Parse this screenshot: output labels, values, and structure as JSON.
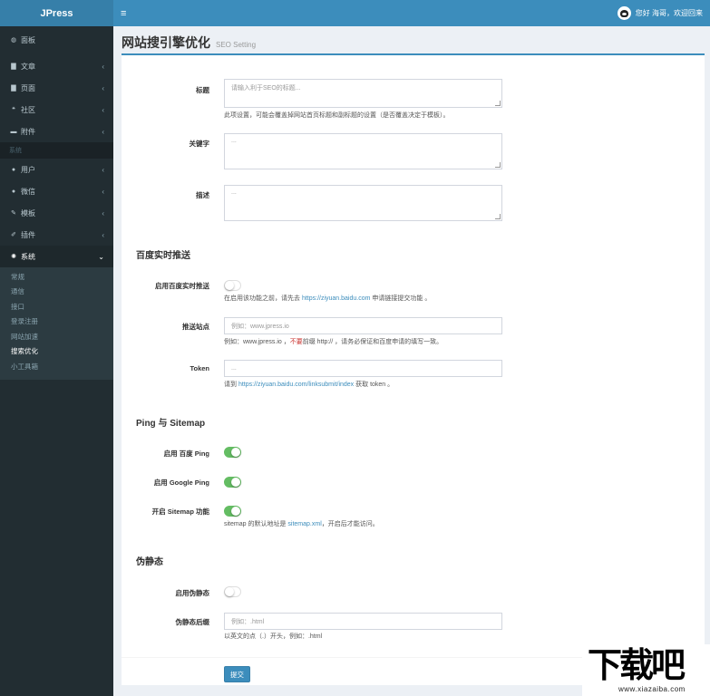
{
  "brand": "JPress",
  "topbar": {
    "menu_icon": "≡",
    "user_text": "您好 海哥，欢迎回来"
  },
  "sidebar": {
    "items": [
      {
        "icon": "dashboard-icon",
        "glyph": "◍",
        "label": "面板",
        "arrow": ""
      },
      {
        "icon": "article-icon",
        "glyph": "▇",
        "label": "文章",
        "arrow": "‹"
      },
      {
        "icon": "page-icon",
        "glyph": "▇",
        "label": "页面",
        "arrow": "‹"
      },
      {
        "icon": "community-icon",
        "glyph": "❝",
        "label": "社区",
        "arrow": "‹"
      },
      {
        "icon": "attachment-icon",
        "glyph": "▬",
        "label": "附件",
        "arrow": "‹"
      }
    ],
    "header": "系统",
    "items2": [
      {
        "icon": "user-icon",
        "glyph": "●",
        "label": "用户",
        "arrow": "‹"
      },
      {
        "icon": "wechat-icon",
        "glyph": "●",
        "label": "微信",
        "arrow": "‹"
      },
      {
        "icon": "template-icon",
        "glyph": "✎",
        "label": "模板",
        "arrow": "‹"
      },
      {
        "icon": "plugin-icon",
        "glyph": "✐",
        "label": "插件",
        "arrow": "‹"
      }
    ],
    "system": {
      "icon": "gear-icon",
      "glyph": "✺",
      "label": "系统",
      "arrow": "⌄"
    },
    "sub_items": [
      "常规",
      "通信",
      "接口",
      "登录注册",
      "网站加速",
      "搜索优化",
      "小工具箱"
    ],
    "active_sub": "搜索优化"
  },
  "page": {
    "title": "网站搜引擎优化",
    "subtitle": "SEO Setting"
  },
  "form": {
    "title_label": "标题",
    "title_placeholder": "请输入利于SEO的标题...",
    "title_help": "此项设置，可能会覆盖掉网站首页标题和副标题的设置（是否覆盖决定于模板）。",
    "keywords_label": "关键字",
    "keywords_placeholder": "...",
    "description_label": "描述",
    "description_placeholder": "...",
    "baidu_section": "百度实时推送",
    "baidu_enable_label": "启用百度实时推送",
    "baidu_enable_on": false,
    "baidu_help_pre": "在启用该功能之前，请先去 ",
    "baidu_help_link": "https://ziyuan.baidu.com",
    "baidu_help_post": " 申请链接提交功能 。",
    "site_label": "推送站点",
    "site_placeholder": "例如：www.jpress.io",
    "site_help_pre": "例如：www.jpress.io ，",
    "site_help_warn": "不要",
    "site_help_post": "前缀 http:// ，请务必保证和百度申请的填写一致。",
    "token_label": "Token",
    "token_placeholder": "...",
    "token_help_pre": "请到 ",
    "token_help_link": "https://ziyuan.baidu.com/linksubmit/index",
    "token_help_post": " 获取 token 。",
    "ping_section": "Ping 与 Sitemap",
    "baidu_ping_label": "启用 百度 Ping",
    "baidu_ping_on": true,
    "google_ping_label": "启用 Google Ping",
    "google_ping_on": true,
    "sitemap_label": "开启 Sitemap 功能",
    "sitemap_on": true,
    "sitemap_help_pre": "sitemap 的默认地址是 ",
    "sitemap_help_link": "sitemap.xml",
    "sitemap_help_post": "，开启后才能访问。",
    "static_section": "伪静态",
    "static_enable_label": "启用伪静态",
    "static_enable_on": false,
    "suffix_label": "伪静态后缀",
    "suffix_placeholder": "例如：.html",
    "suffix_help": "以英文的点（.）开头，例如：.html",
    "submit_label": "提交"
  },
  "watermark": {
    "main": "下载吧",
    "sub": "www.xiazaiba.com"
  }
}
